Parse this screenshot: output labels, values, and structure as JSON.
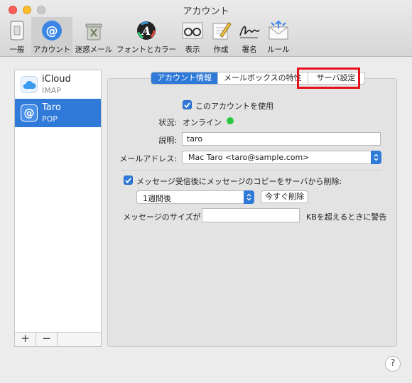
{
  "window": {
    "title": "アカウント"
  },
  "toolbar": {
    "items": [
      {
        "label": "一般"
      },
      {
        "label": "アカウント"
      },
      {
        "label": "迷惑メール"
      },
      {
        "label": "フォントとカラー"
      },
      {
        "label": "表示"
      },
      {
        "label": "作成"
      },
      {
        "label": "署名"
      },
      {
        "label": "ルール"
      }
    ],
    "selected": "アカウント"
  },
  "accounts": [
    {
      "name": "iCloud",
      "type": "IMAP"
    },
    {
      "name": "Taro",
      "type": "POP",
      "selected": true
    }
  ],
  "list_footer": {
    "add": "+",
    "remove": "−"
  },
  "tabs": [
    {
      "label": "アカウント情報",
      "active": true
    },
    {
      "label": "メールボックスの特性"
    },
    {
      "label": "サーバ設定",
      "highlighted": true
    }
  ],
  "form": {
    "use_account_label": "このアカウントを使用",
    "use_account_checked": true,
    "status_label": "状況:",
    "status_value": "オンライン",
    "status_color": "#2ac840",
    "description_label": "説明:",
    "description_value": "taro",
    "email_label": "メールアドレス:",
    "email_value": "Mac Taro <taro@sample.com>",
    "remove_copy_label": "メッセージ受信後にメッセージのコピーをサーバから削除:",
    "remove_copy_checked": true,
    "period_value": "1週間後",
    "remove_now_button": "今すぐ削除",
    "size_label": "メッセージのサイズが",
    "size_value": "",
    "size_suffix": "KBを超えるときに警告"
  },
  "help_button": "?",
  "colors": {
    "accent": "#2f7ad9",
    "highlight_box": "#e6101a"
  }
}
